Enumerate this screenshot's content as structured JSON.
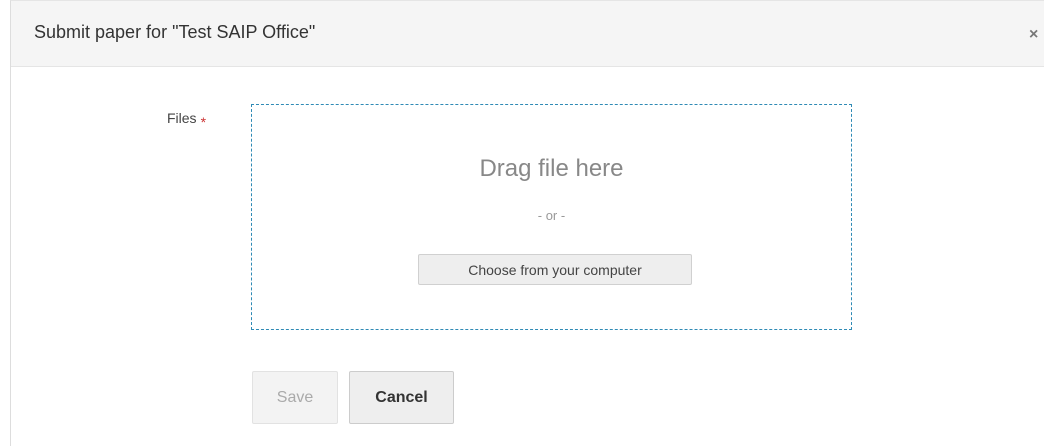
{
  "dialog": {
    "title": "Submit paper for \"Test SAIP Office\"",
    "close_icon": "×"
  },
  "form": {
    "files_label": "Files",
    "required_marker": "*",
    "drop_zone": {
      "title": "Drag file here",
      "or_text": "- or -",
      "choose_label": "Choose from your computer"
    }
  },
  "actions": {
    "save_label": "Save",
    "save_disabled": true,
    "cancel_label": "Cancel"
  },
  "colors": {
    "drop_zone_border": "#2f8ab5",
    "required": "#cc3333"
  }
}
